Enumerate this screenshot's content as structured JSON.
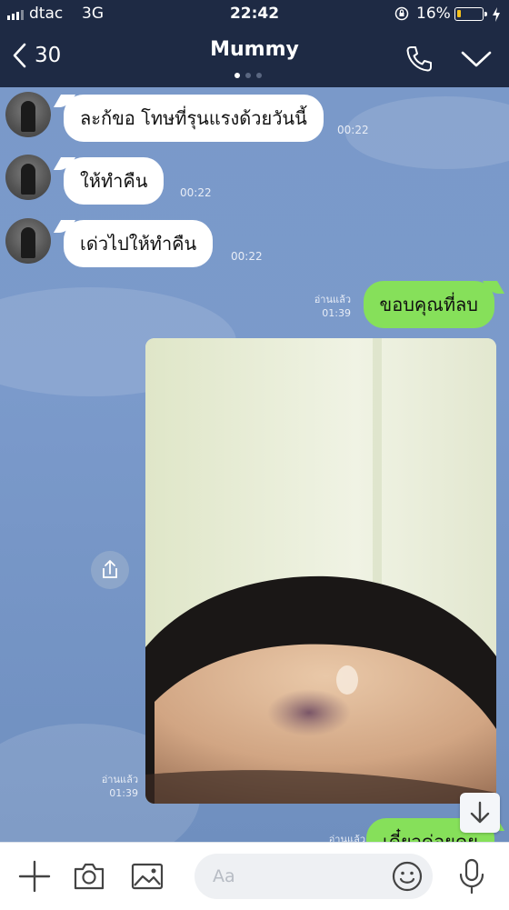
{
  "status_bar": {
    "carrier": "dtac",
    "network": "3G",
    "time": "22:42",
    "battery_percent": "16%",
    "battery_level": 0.16,
    "battery_color": "#f6c21c",
    "icons": [
      "signal-icon",
      "rotation-lock-icon",
      "battery-icon",
      "charging-bolt-icon"
    ]
  },
  "header": {
    "back_count": "30",
    "title": "Mummy",
    "page_dots": 3,
    "active_dot": 0,
    "icons": [
      "back-chevron-icon",
      "phone-icon",
      "chevron-down-icon"
    ]
  },
  "messages": [
    {
      "direction": "in",
      "text": "ละก้ขอ โทษที่รุนแรงด้วยวันนี้",
      "time": "00:22"
    },
    {
      "direction": "in",
      "text": "ให้ทำคืน",
      "time": "00:22"
    },
    {
      "direction": "in",
      "text": "เด่วไปให้ทำคืน",
      "time": "00:22"
    },
    {
      "direction": "out",
      "text": "ขอบคุณที่ลบ",
      "read": "อ่านแล้ว",
      "time": "01:39"
    },
    {
      "direction": "out",
      "type": "image",
      "read": "อ่านแล้ว",
      "time": "01:39"
    },
    {
      "direction": "out",
      "text": "เดี๋ยวค่อยคุย",
      "read": "อ่านแล้ว",
      "partial": true
    }
  ],
  "input_bar": {
    "placeholder": "Aa",
    "icons": [
      "plus-icon",
      "camera-icon",
      "image-icon",
      "emoji-icon",
      "mic-icon"
    ]
  },
  "colors": {
    "header_bg": "#1e2a44",
    "chat_bg": "#7b9acb",
    "incoming_bubble": "#ffffff",
    "outgoing_bubble": "#86e05a"
  }
}
